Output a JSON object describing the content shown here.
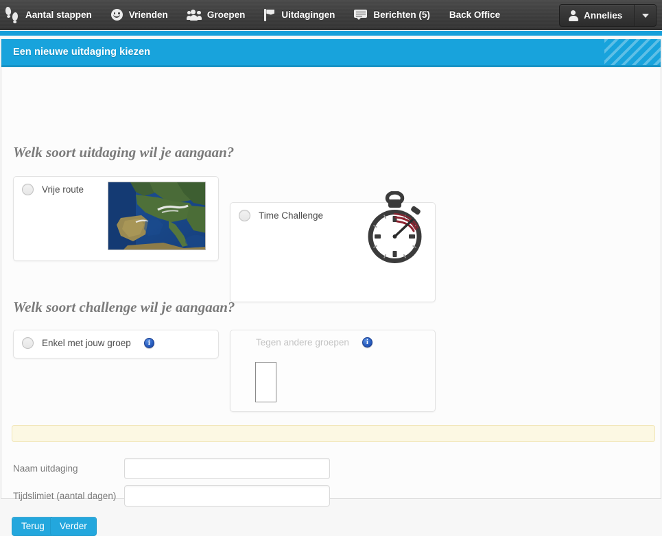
{
  "navbar": {
    "items": [
      {
        "label": "Aantal stappen",
        "icon": "footsteps-icon"
      },
      {
        "label": "Vrienden",
        "icon": "smiley-icon"
      },
      {
        "label": "Groepen",
        "icon": "group-icon"
      },
      {
        "label": "Uitdagingen",
        "icon": "flag-icon"
      },
      {
        "label": "Berichten (5)",
        "icon": "message-icon"
      },
      {
        "label": "Back Office",
        "icon": "none"
      }
    ],
    "user": {
      "name": "Annelies",
      "avatar_icon": "person-icon",
      "caret_icon": "chevron-down-icon"
    },
    "background_color": "#3b3b3b",
    "accent_color": "#169fda"
  },
  "panel": {
    "title": "Een nieuwe uitdaging kiezen",
    "header_color": "#18a3dc"
  },
  "sections": [
    {
      "heading": "Welk soort uitdaging wil je aangaan?",
      "options": [
        {
          "label": "Vrije route",
          "selected": false,
          "disabled": false,
          "media": "europe-satellite-map"
        },
        {
          "label": "Time Challenge",
          "selected": false,
          "disabled": false,
          "media": "stopwatch-illustration"
        }
      ]
    },
    {
      "heading": "Welk soort challenge wil je aangaan?",
      "options": [
        {
          "label": "Enkel met jouw groep",
          "selected": false,
          "disabled": false,
          "info": "i",
          "media": "none"
        },
        {
          "label": "Tegen andere groepen",
          "selected": false,
          "disabled": true,
          "info": "i",
          "media": "empty-select-box"
        }
      ]
    }
  ],
  "alert": {
    "text": "",
    "background_color": "#fcf8e3",
    "border_color": "#f0e4b4"
  },
  "form": {
    "fields": [
      {
        "label": "Naam uitdaging",
        "value": "",
        "placeholder": ""
      },
      {
        "label": "Tijdslimiet (aantal dagen)",
        "value": "",
        "placeholder": ""
      }
    ]
  },
  "buttons": {
    "back_label": "Terug",
    "next_label": "Verder",
    "color": "#23a7dd"
  }
}
